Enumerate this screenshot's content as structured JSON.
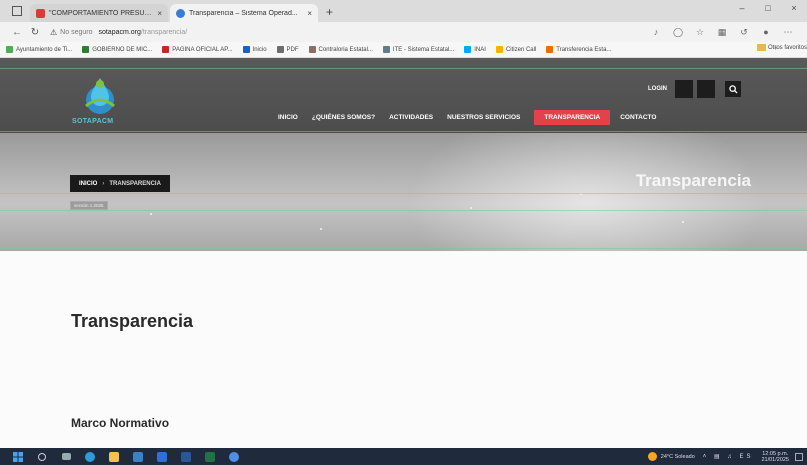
{
  "browser": {
    "tabs": [
      {
        "title": "\"COMPORTAMIENTO PRESUPU...",
        "favicon_color": "#d93b3b",
        "active": false
      },
      {
        "title": "Transparencia – Sistema Operad...",
        "favicon_color": "#3a7bd5",
        "active": true
      }
    ],
    "tab_close": "×",
    "new_tab": "+",
    "window_controls": [
      "–",
      "□",
      "×"
    ],
    "url_security": "No seguro",
    "url_domain": "sotapacm.org",
    "url_path": "/transparencia/",
    "nav": {
      "back": "←",
      "reload": "↻"
    },
    "bookmarks": [
      {
        "label": "Ayuntamiento de Ti...",
        "color": "#4caf50"
      },
      {
        "label": "GOBIERNO DE MIC...",
        "color": "#2e7d32"
      },
      {
        "label": "PAGINA OFICIAL AP...",
        "color": "#c62828"
      },
      {
        "label": "Inicio",
        "color": "#1565c0"
      },
      {
        "label": "PDF",
        "color": "#6d6d6d"
      },
      {
        "label": "Contraloria Estatal...",
        "color": "#8d6e63"
      },
      {
        "label": "ITE - Sistema Estatal...",
        "color": "#607d8b"
      },
      {
        "label": "INAI",
        "color": "#03a9f4"
      },
      {
        "label": "Citizen Call",
        "color": "#ffb300"
      },
      {
        "label": "Transferencia Esta...",
        "color": "#ef6c00"
      }
    ],
    "bookmarks_more": "›",
    "bookmarks_folder": "Otros favoritos"
  },
  "site": {
    "logo_text": "SOTAPACM",
    "login": "LOGIN",
    "nav": [
      "INICIO",
      "¿QUIÉNES SOMOS?",
      "ACTIVIDADES",
      "NUESTROS SERVICIOS",
      "TRANSPARENCIA",
      "CONTACTO"
    ],
    "nav_active_index": 4,
    "accent_color": "#e2434b",
    "breadcrumb": {
      "home": "INICIO",
      "sep": "›",
      "current": "TRANSPARENCIA"
    },
    "version_badge": "versión 1.2025",
    "hero_title": "Transparencia"
  },
  "content": {
    "page_title": "Transparencia",
    "section_title": "Marco Normativo"
  },
  "taskbar": {
    "weather": "24°C Soleado",
    "time": "12:05 p.m.",
    "date": "21/01/2025"
  }
}
